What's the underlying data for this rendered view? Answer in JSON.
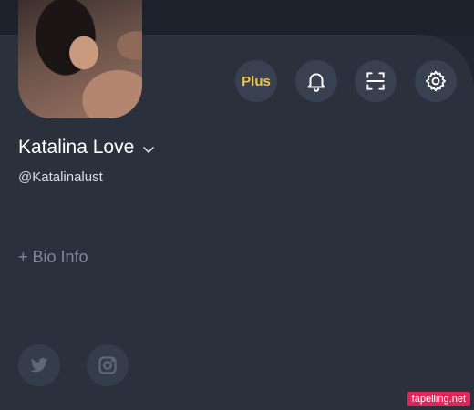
{
  "profile": {
    "display_name": "Katalina Love",
    "handle": "@Katalinalust",
    "bio_link": "+ Bio Info"
  },
  "actions": {
    "plus_label": "Plus",
    "bell_icon": "bell-icon",
    "scan_icon": "scan-icon",
    "settings_icon": "gear-icon"
  },
  "social": {
    "twitter_icon": "twitter-icon",
    "instagram_icon": "instagram-icon"
  },
  "colors": {
    "background": "#1f2631",
    "panel": "#2a313d",
    "button_bg": "#394150",
    "plus_accent": "#f1c34a",
    "muted_text": "#7f8898",
    "watermark_bg": "#e0265b"
  },
  "watermark": {
    "text": "fapelling.net"
  }
}
